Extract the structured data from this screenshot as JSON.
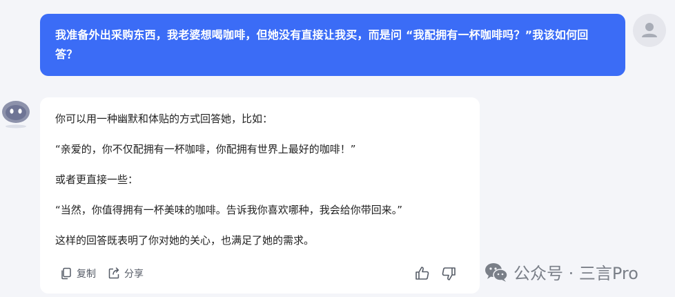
{
  "user_message": {
    "text": "我准备外出采购东西，我老婆想喝咖啡，但她没有直接让我买，而是问 “我配拥有一杯咖啡吗？”我该如何回答？"
  },
  "bot_message": {
    "paragraphs": [
      "你可以用一种幽默和体贴的方式回答她，比如：",
      "“亲爱的，你不仅配拥有一杯咖啡，你配拥有世界上最好的咖啡！”",
      "或者更直接一些：",
      "“当然，你值得拥有一杯美味的咖啡。告诉我你喜欢哪种，我会给你带回来。”",
      "这样的回答既表明了你对她的关心，也满足了她的需求。"
    ]
  },
  "actions": {
    "copy_label": "复制",
    "share_label": "分享"
  },
  "watermark": {
    "text": "公众号 · 三言Pro"
  },
  "colors": {
    "user_bubble": "#3b6cf6",
    "bot_bubble": "#ffffff",
    "background": "#f4f5f9"
  }
}
